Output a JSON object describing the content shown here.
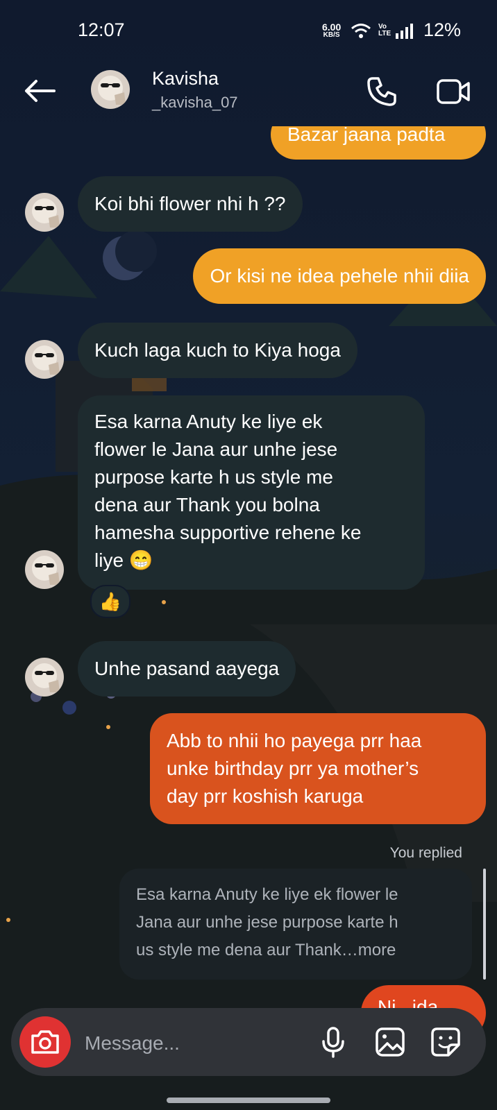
{
  "status_bar": {
    "time": "12:07",
    "net_speed_value": "6.00",
    "net_speed_unit": "KB/S",
    "volte": "Vo LTE",
    "battery": "12%"
  },
  "header": {
    "contact_name": "Kavisha",
    "contact_handle": "_kavisha_07"
  },
  "messages": [
    {
      "side": "outgoing",
      "text": "Bazar jaana padta"
    },
    {
      "side": "incoming",
      "text": "Koi bhi flower nhi h ??"
    },
    {
      "side": "outgoing",
      "text": "Or kisi ne idea pehele nhii diia"
    },
    {
      "side": "incoming",
      "text": "Kuch laga kuch to Kiya hoga"
    },
    {
      "side": "incoming",
      "lines": [
        "Esa karna Anuty ke liye ek",
        "flower le Jana aur unhe jese",
        "purpose karte h us style me",
        "dena aur Thank you bolna",
        "hamesha supportive rehene ke",
        "liye 😁"
      ],
      "reaction": "👍"
    },
    {
      "side": "incoming",
      "text": "Unhe pasand aayega"
    },
    {
      "side": "outgoing",
      "lines": [
        "Abb to nhii ho payega prr haa",
        "unke birthday prr ya mother’s",
        "day prr koshish karuga"
      ]
    },
    {
      "side": "outgoing",
      "text": "Ni...ida..."
    }
  ],
  "reply": {
    "label": "You replied",
    "quote_lines": [
      "Esa karna Anuty ke liye ek flower le",
      "Jana aur unhe jese purpose karte h",
      "us style me dena aur Thank…more"
    ]
  },
  "composer": {
    "placeholder": "Message..."
  },
  "icons": [
    "back-arrow-icon",
    "phone-icon",
    "video-icon",
    "camera-icon",
    "microphone-icon",
    "gallery-icon",
    "sticker-icon",
    "wifi-icon",
    "signal-icon"
  ],
  "colors": {
    "outgoing": "#f0a126",
    "outgoing_dark": "#d9531e",
    "incoming": "#1e2b2f",
    "camera": "#e03232",
    "background": "#111a2b"
  }
}
